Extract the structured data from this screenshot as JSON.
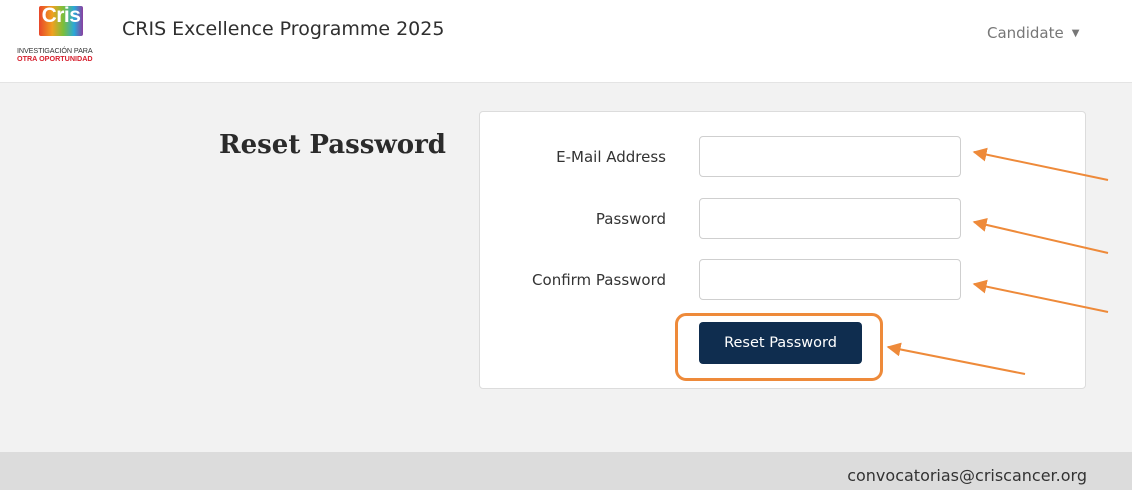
{
  "navbar": {
    "logo": {
      "word": "Cris",
      "tagline_1": "INVESTIGACIÓN PARA",
      "tagline_2": "OTRA OPORTUNIDAD"
    },
    "title": "CRIS Excellence Programme 2025",
    "user_menu_label": "Candidate"
  },
  "page": {
    "heading": "Reset Password"
  },
  "form": {
    "email_label": "E-Mail Address",
    "email_value": "",
    "password_label": "Password",
    "password_value": "",
    "confirm_label": "Confirm Password",
    "confirm_value": "",
    "submit_label": "Reset Password"
  },
  "footer": {
    "email": "convocatorias@criscancer.org"
  },
  "colors": {
    "primary_button": "#0f2d4f",
    "annotation": "#ee8a3a",
    "background": "#f2f2f2"
  }
}
